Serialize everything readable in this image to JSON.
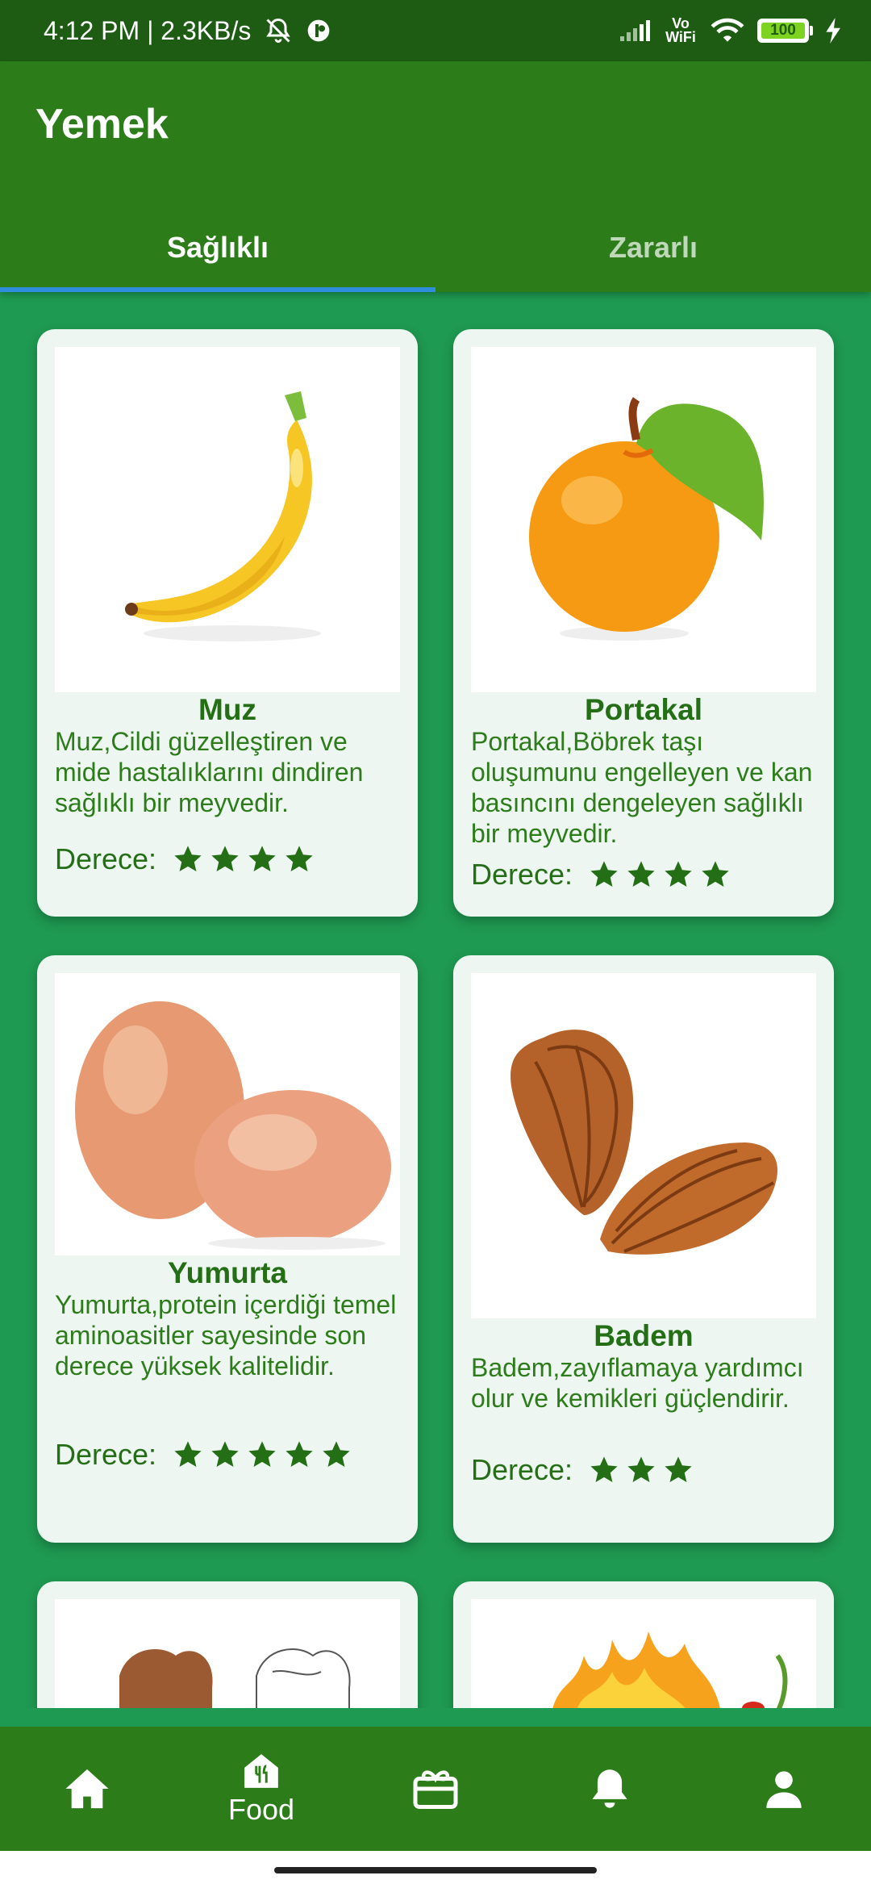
{
  "status_bar": {
    "time_speed": "4:12 PM | 2.3KB/s",
    "vowifi": "Vo WiFi",
    "battery": "100",
    "icons": [
      "mute-bell-icon",
      "circle-app-icon",
      "signal-icon",
      "wifi-icon",
      "battery-icon",
      "charging-icon"
    ]
  },
  "app_bar": {
    "title": "Yemek",
    "tabs": [
      {
        "label": "Sağlıklı",
        "selected": true
      },
      {
        "label": "Zararlı",
        "selected": false
      }
    ]
  },
  "rating_label": "Derece:",
  "foods": [
    {
      "name": "Muz",
      "description": "Muz,Cildi güzelleştiren ve mide hastalıklarını dindiren sağlıklı bir meyvedir.",
      "stars": 4,
      "image": "banana-image"
    },
    {
      "name": "Portakal",
      "description": "Portakal,Böbrek taşı oluşumunu engelleyen ve kan basıncını dengeleyen sağlıklı bir meyvedir.",
      "stars": 4,
      "image": "orange-image"
    },
    {
      "name": "Yumurta",
      "description": "Yumurta,protein içerdiği temel aminoasitler sayesinde son derece yüksek kalitelidir.",
      "stars": 5,
      "image": "eggs-image"
    },
    {
      "name": "Badem",
      "description": "Badem,zayıflamaya yardımcı olur ve kemikleri güçlendirir.",
      "stars": 3,
      "image": "almonds-image"
    },
    {
      "image": "walnut-image"
    },
    {
      "image": "fire-pepper-image"
    }
  ],
  "bottom_nav": [
    {
      "icon": "home-icon",
      "label": ""
    },
    {
      "icon": "food-icon",
      "label": "Food",
      "selected": true
    },
    {
      "icon": "gift-card-icon",
      "label": ""
    },
    {
      "icon": "bell-icon",
      "label": ""
    },
    {
      "icon": "person-icon",
      "label": ""
    }
  ],
  "colors": {
    "status_bar": "#1e5c14",
    "app_bar": "#2c7c1a",
    "background": "#1f9a52",
    "card": "#eef6f2",
    "tab_indicator": "#2f8ddd",
    "star": "#246f16"
  }
}
